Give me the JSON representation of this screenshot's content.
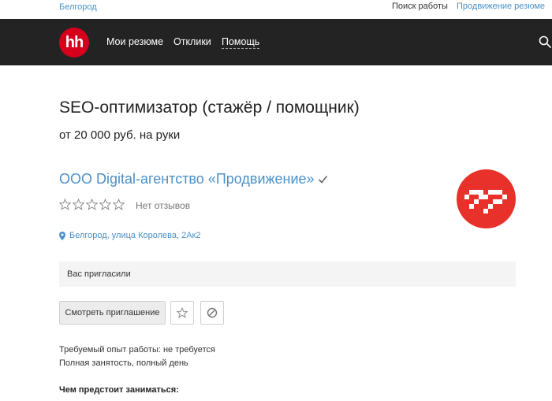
{
  "topbar": {
    "city": "Белгород",
    "find_job": "Поиск работы",
    "promote_resume": "Продвижение резюме"
  },
  "nav": {
    "logo_text": "hh",
    "items": [
      {
        "label": "Мои резюме"
      },
      {
        "label": "Отклики"
      },
      {
        "label": "Помощь"
      }
    ],
    "search_icon": "search-icon"
  },
  "vacancy": {
    "title": "SEO-оптимизатор (стажёр / помощник)",
    "salary": "от 20 000 руб. на руки",
    "company": "ООО Digital-агентство «Продвижение»",
    "verified_icon": "check-icon",
    "rating_stars": 0,
    "rating_max": 5,
    "reviews": "Нет отзывов",
    "address": "Белгород, улица Королева, 2Ак2",
    "invite_status": "Вас пригласили",
    "view_invite_button": "Смотреть приглашение",
    "experience": "Требуемый опыт работы: не требуется",
    "employment": "Полная занятость, полный день",
    "duties_heading": "Чем предстоит заниматься:"
  },
  "colors": {
    "link": "#4a90c8",
    "navbar": "#232323",
    "hh_logo": "#d6001c",
    "company_logo": "#e8312a"
  }
}
